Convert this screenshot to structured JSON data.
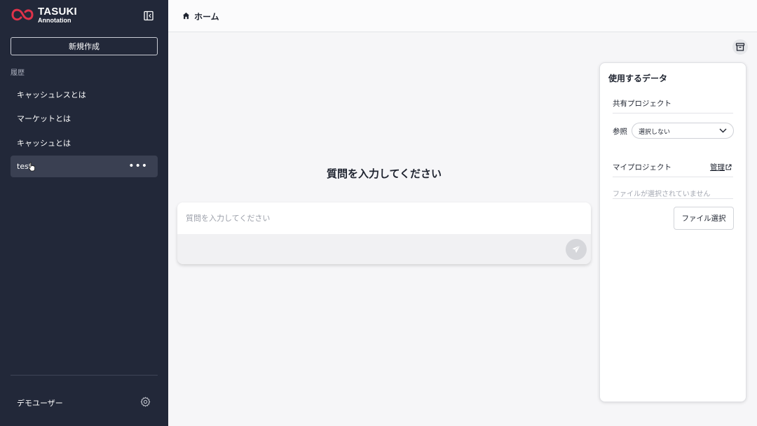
{
  "app": {
    "logo_title": "TASUKI",
    "logo_subtitle": "Annotation",
    "brand_color": "#e0334a"
  },
  "sidebar": {
    "new_button_label": "新規作成",
    "history_label": "履歴",
    "items": [
      {
        "label": "キャッシュレスとは"
      },
      {
        "label": "マーケットとは"
      },
      {
        "label": "キャッシュとは"
      },
      {
        "label": "test",
        "more_label": "•••"
      }
    ],
    "user_name": "デモユーザー",
    "icons": {
      "collapse": "sidebar-collapse-icon",
      "settings": "gear-icon"
    }
  },
  "header": {
    "breadcrumb": "ホーム",
    "icon": "home-icon"
  },
  "main": {
    "title": "質問を入力してください",
    "input_placeholder": "質問を入力してください",
    "icons": {
      "send": "send-icon",
      "archive": "archive-icon"
    }
  },
  "panel": {
    "title": "使用するデータ",
    "shared_project_label": "共有プロジェクト",
    "reference_label": "参照",
    "reference_value": "選択しない",
    "my_project_label": "マイプロジェクト",
    "manage_label": "管理",
    "no_file_text": "ファイルが選択されていません",
    "file_button_label": "ファイル選択"
  }
}
